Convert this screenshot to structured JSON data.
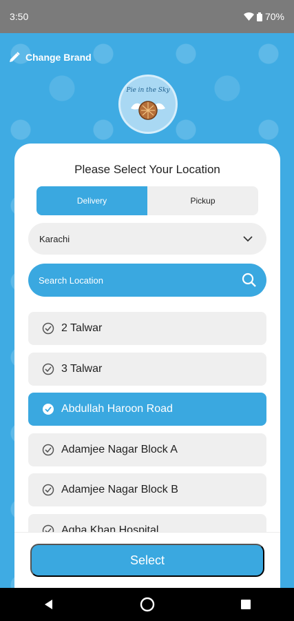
{
  "status_bar": {
    "time": "3:50",
    "battery": "70%"
  },
  "brand": {
    "change_label": "Change Brand",
    "logo_text": "Pie in the Sky"
  },
  "card": {
    "title": "Please Select Your Location",
    "tabs": [
      "Delivery",
      "Pickup"
    ],
    "city": "Karachi",
    "search_placeholder": "Search Location",
    "locations": [
      "2 Talwar",
      "3 Talwar",
      "Abdullah Haroon Road",
      "Adamjee Nagar Block A",
      "Adamjee Nagar Block B",
      "Agha Khan Hospital"
    ],
    "selected_location": "Abdullah Haroon Road",
    "select_button": "Select"
  },
  "colors": {
    "primary": "#3aa8e0",
    "background": "#3fabe3",
    "card": "#ffffff"
  }
}
